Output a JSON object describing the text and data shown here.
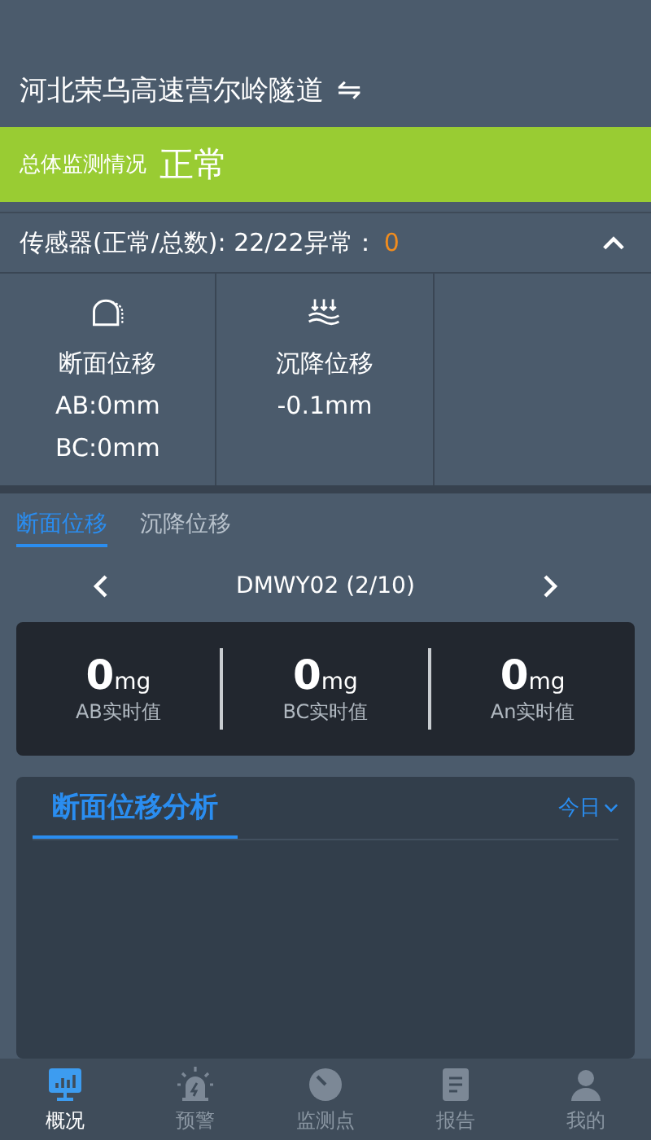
{
  "header": {
    "title": "河北荣乌高速营尔岭隧道",
    "switch_icon": "⇋"
  },
  "status": {
    "label": "总体监测情况",
    "value": "正常"
  },
  "sensors": {
    "label": "传感器(正常/总数): 22/22异常：",
    "abnormal": "0",
    "expanded": true
  },
  "categories": [
    {
      "kind": "section",
      "name": "断面位移",
      "lines": [
        "AB:0mm",
        "BC:0mm"
      ]
    },
    {
      "kind": "settlement",
      "name": "沉降位移",
      "lines": [
        "-0.1mm"
      ]
    },
    {
      "kind": "empty"
    }
  ],
  "tabs": [
    {
      "label": "断面位移",
      "selected": true
    },
    {
      "label": "沉降位移",
      "selected": false
    }
  ],
  "point": {
    "label": "DMWY02 (2/10)"
  },
  "readings": [
    {
      "value": "0",
      "unit": "mg",
      "label": "AB实时值"
    },
    {
      "value": "0",
      "unit": "mg",
      "label": "BC实时值"
    },
    {
      "value": "0",
      "unit": "mg",
      "label": "An实时值"
    }
  ],
  "analysis": {
    "title": "断面位移分析",
    "range": "今日"
  },
  "nav": [
    {
      "kind": "overview",
      "label": "概况",
      "selected": true
    },
    {
      "kind": "alarm",
      "label": "预警",
      "selected": false
    },
    {
      "kind": "points",
      "label": "监测点",
      "selected": false
    },
    {
      "kind": "report",
      "label": "报告",
      "selected": false
    },
    {
      "kind": "me",
      "label": "我的",
      "selected": false
    }
  ]
}
